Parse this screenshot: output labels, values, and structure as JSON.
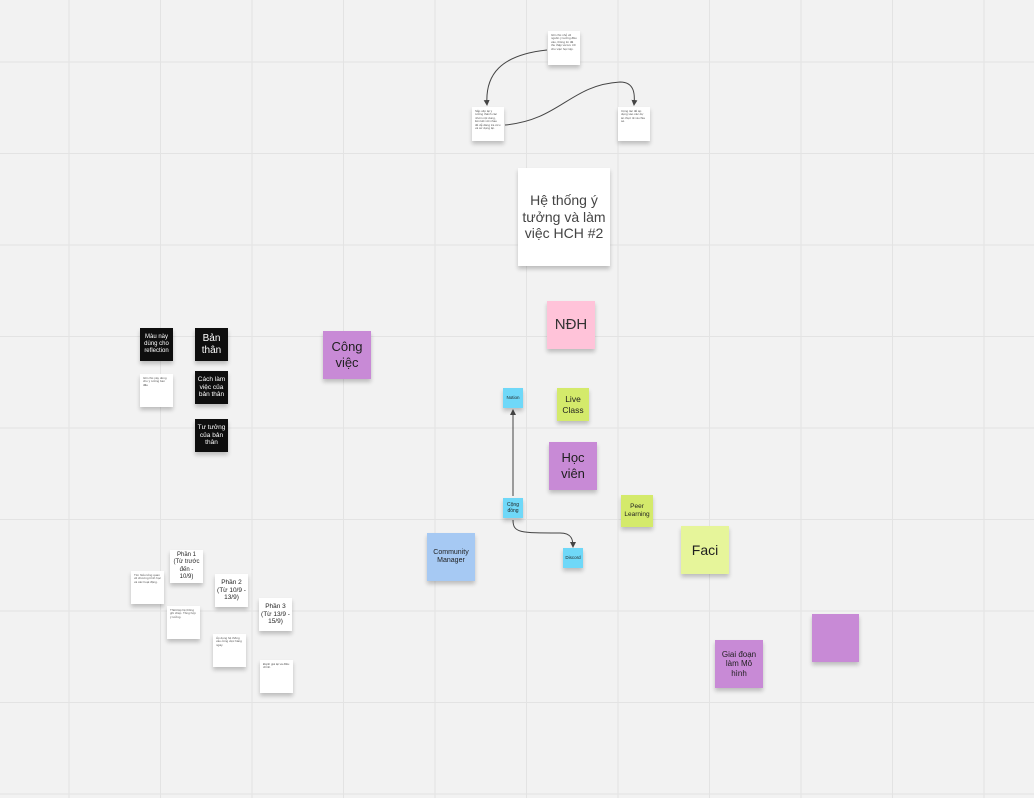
{
  "board": {
    "title_note": "Hệ thống ý tưởng và làm việc HCH #2",
    "top_notes": {
      "top": "Ghi chú nhỏ về nguồn ý tưởng đầu vào, thông tin đã thu thập và lưu trữ cho việc học tập.",
      "left": "Sắp xếp lại ý tưởng thành các nhóm nội dung, liên kết với nhau để dễ dàng tra cứu và sử dụng lại.",
      "right": "Cộng tác để áp dụng vào các dự án thực tế và chia sẻ."
    },
    "ndh": "NĐH",
    "cong_viec": "Công việc",
    "legend": {
      "color_note": "Màu này dùng cho reflection",
      "small_white": "Ghi chú này dùng cho ý tưởng ban đầu",
      "ban_than": "Bản thân",
      "cach_lam_viec": "Cách làm việc của bản thân",
      "tu_tuong": "Tư tưởng của bản thân"
    },
    "notion": "Notion",
    "live_class": "Live Class",
    "hoc_vien": "Học viên",
    "cong_dong": "Cộng đồng",
    "peer_learning": "Peer Learning",
    "discord": "Discord",
    "community_manager": "Community Manager",
    "faci": "Faci",
    "giai_doan": "Giai đoạn làm Mô hình",
    "empty_purple": "",
    "phases": {
      "p1": "Phần 1 (Từ trước đến - 10/9)",
      "p2": "Phần 2 (Từ 10/9 - 13/9)",
      "p3": "Phần 3 (Từ 13/9 - 15/9)",
      "tiny1": "Tìm hiểu tổng quan về chương trình học và các hoạt động.",
      "tiny2": "Thiết lập hệ thống ghi chép. Tổng hợp ý tưởng.",
      "tiny3": "Áp dụng hệ thống vào công việc hàng ngày.",
      "tiny4": "Đánh giá lại và điều chỉnh."
    }
  },
  "colors": {
    "purple": "#c88ad6",
    "pink": "#ffc3d9",
    "lime": "#d4ea6b",
    "cyan": "#6fd8f8",
    "blue": "#a6c9f3",
    "black": "#0e0e0e"
  }
}
